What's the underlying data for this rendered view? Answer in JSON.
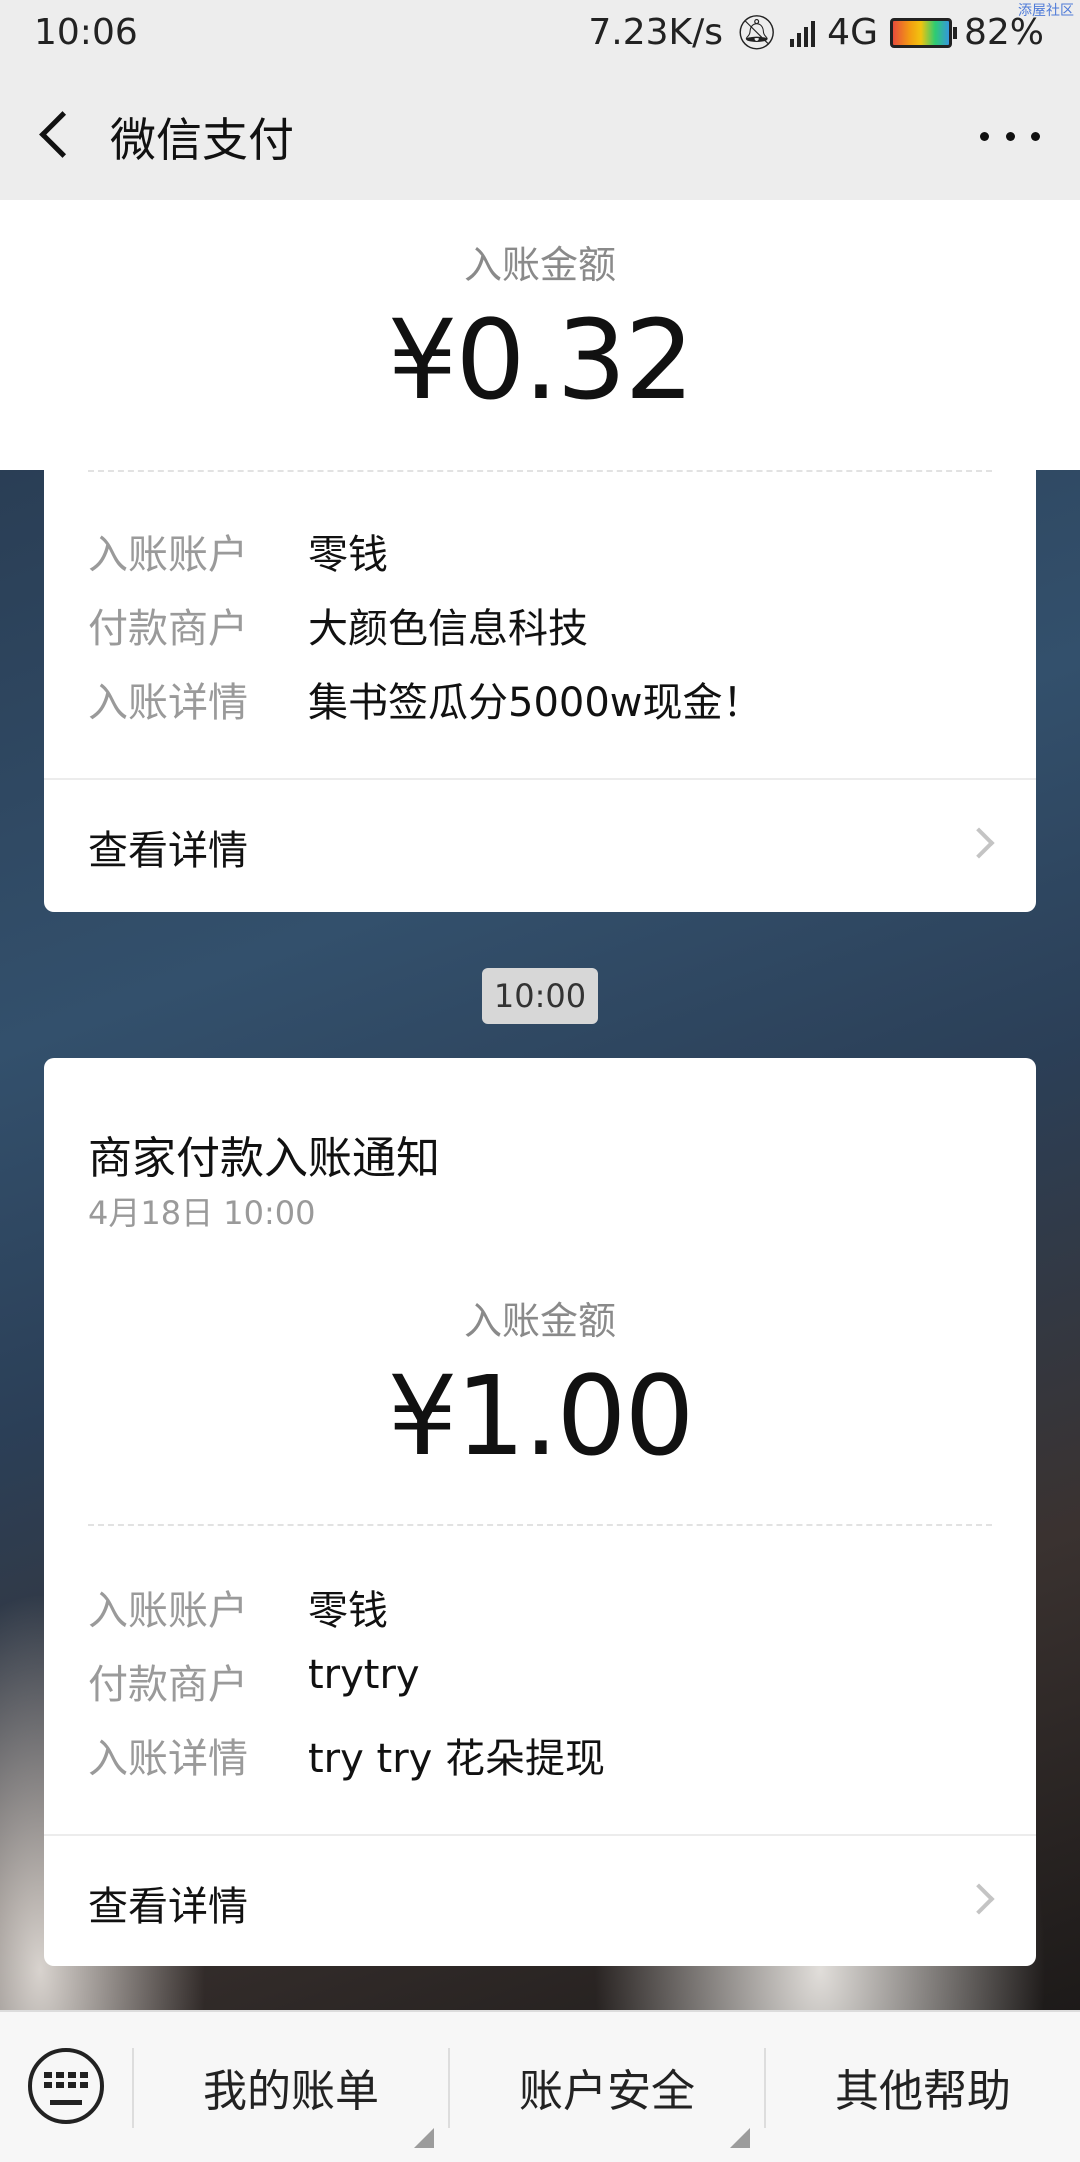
{
  "status_bar": {
    "time": "10:06",
    "network_speed": "7.23K/s",
    "network_type": "4G",
    "battery": "82%",
    "watermark": "添屋社区"
  },
  "nav": {
    "title": "微信支付",
    "back_icon": "chevron-left-icon",
    "more_icon": "more-horizontal-icon"
  },
  "card1": {
    "amount_label": "入账金额",
    "amount": "¥0.32",
    "rows": [
      {
        "label": "入账账户",
        "value": "零钱"
      },
      {
        "label": "付款商户",
        "value": "大颜色信息科技"
      },
      {
        "label": "入账详情",
        "value": "集书签瓜分5000w现金！"
      }
    ],
    "detail_link": "查看详情"
  },
  "time_separator": "10:00",
  "card2": {
    "title": "商家付款入账通知",
    "date": "4月18日  10:00",
    "amount_label": "入账金额",
    "amount": "¥1.00",
    "rows": [
      {
        "label": "入账账户",
        "value": "零钱"
      },
      {
        "label": "付款商户",
        "value": "trytry"
      },
      {
        "label": "入账详情",
        "value": "try try 花朵提现"
      }
    ],
    "detail_link": "查看详情"
  },
  "bottom_menu": {
    "keyboard_icon": "keyboard-icon",
    "items": [
      "我的账单",
      "账户安全",
      "其他帮助"
    ]
  }
}
